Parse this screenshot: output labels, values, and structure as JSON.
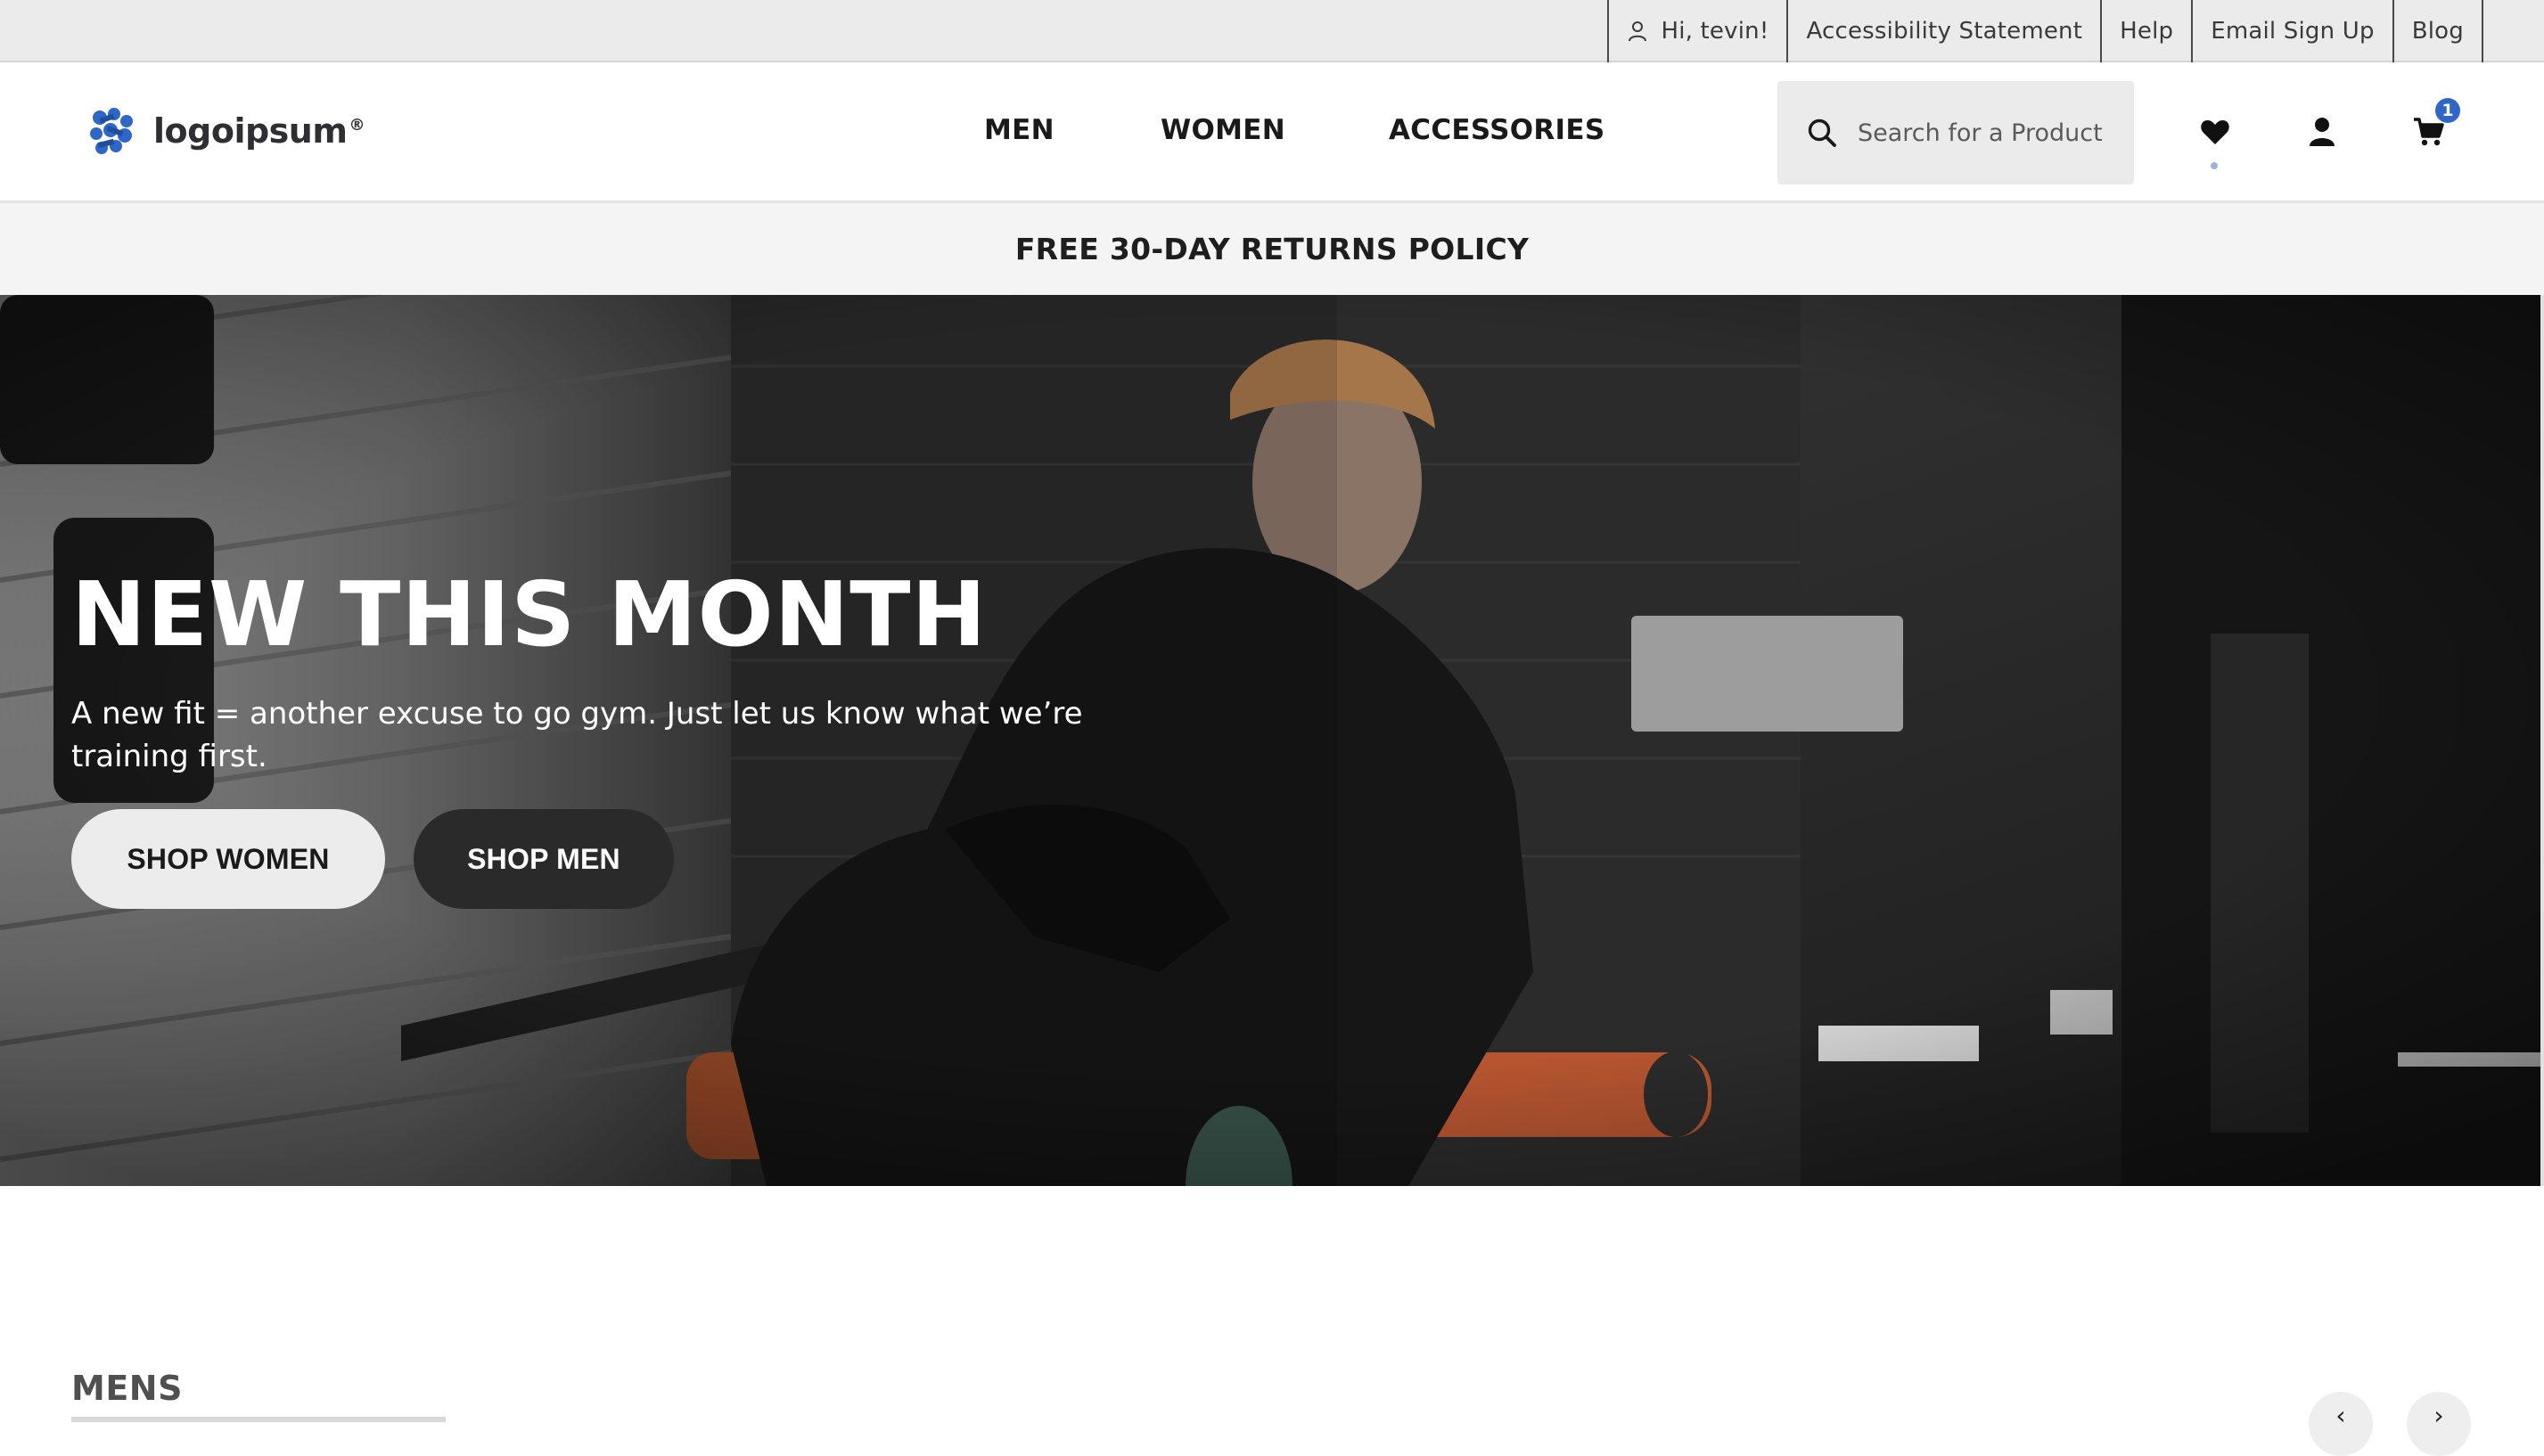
{
  "utility_bar": {
    "greeting": "Hi, tevin!",
    "links": [
      "Accessibility Statement",
      "Help",
      "Email Sign Up",
      "Blog"
    ]
  },
  "header": {
    "logo_text": "logoipsum",
    "logo_mark": "®",
    "nav": [
      "MEN",
      "WOMEN",
      "ACCESSORIES"
    ],
    "search_placeholder": "Search for a Product",
    "cart_count": "1",
    "icons": [
      "search-icon",
      "heart-icon",
      "user-icon",
      "cart-icon"
    ]
  },
  "promo": {
    "text": "FREE 30-DAY RETURNS POLICY"
  },
  "hero": {
    "title": "NEW THIS MONTH",
    "subtitle": "A new fit = another excuse to go gym. Just let us know what we’re training first.",
    "buttons": {
      "women": "SHOP WOMEN",
      "men": "SHOP MEN"
    }
  },
  "section": {
    "title": "MENS",
    "prev_icon": "‹",
    "next_icon": "›"
  },
  "colors": {
    "utility_bg": "#ebebeb",
    "promo_bg": "#f4f4f4",
    "badge": "#2f67c8",
    "dark_button": "#2a2a2a",
    "light_button": "#ececec"
  }
}
